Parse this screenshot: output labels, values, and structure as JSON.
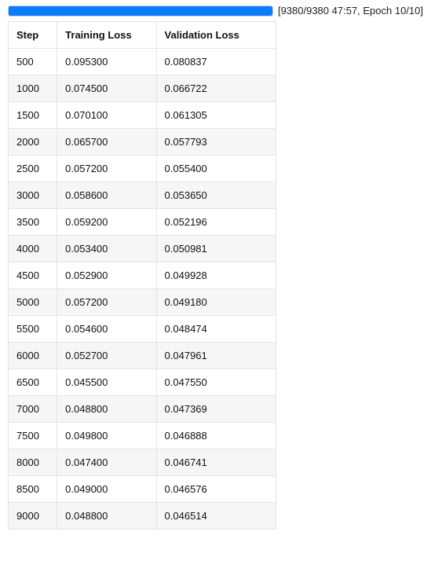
{
  "progress": {
    "percent": 100,
    "label": "[9380/9380 47:57, Epoch 10/10]"
  },
  "table": {
    "headers": {
      "step": "Step",
      "training_loss": "Training Loss",
      "validation_loss": "Validation Loss"
    },
    "rows": [
      {
        "step": "500",
        "training_loss": "0.095300",
        "validation_loss": "0.080837"
      },
      {
        "step": "1000",
        "training_loss": "0.074500",
        "validation_loss": "0.066722"
      },
      {
        "step": "1500",
        "training_loss": "0.070100",
        "validation_loss": "0.061305"
      },
      {
        "step": "2000",
        "training_loss": "0.065700",
        "validation_loss": "0.057793"
      },
      {
        "step": "2500",
        "training_loss": "0.057200",
        "validation_loss": "0.055400"
      },
      {
        "step": "3000",
        "training_loss": "0.058600",
        "validation_loss": "0.053650"
      },
      {
        "step": "3500",
        "training_loss": "0.059200",
        "validation_loss": "0.052196"
      },
      {
        "step": "4000",
        "training_loss": "0.053400",
        "validation_loss": "0.050981"
      },
      {
        "step": "4500",
        "training_loss": "0.052900",
        "validation_loss": "0.049928"
      },
      {
        "step": "5000",
        "training_loss": "0.057200",
        "validation_loss": "0.049180"
      },
      {
        "step": "5500",
        "training_loss": "0.054600",
        "validation_loss": "0.048474"
      },
      {
        "step": "6000",
        "training_loss": "0.052700",
        "validation_loss": "0.047961"
      },
      {
        "step": "6500",
        "training_loss": "0.045500",
        "validation_loss": "0.047550"
      },
      {
        "step": "7000",
        "training_loss": "0.048800",
        "validation_loss": "0.047369"
      },
      {
        "step": "7500",
        "training_loss": "0.049800",
        "validation_loss": "0.046888"
      },
      {
        "step": "8000",
        "training_loss": "0.047400",
        "validation_loss": "0.046741"
      },
      {
        "step": "8500",
        "training_loss": "0.049000",
        "validation_loss": "0.046576"
      },
      {
        "step": "9000",
        "training_loss": "0.048800",
        "validation_loss": "0.046514"
      }
    ]
  }
}
